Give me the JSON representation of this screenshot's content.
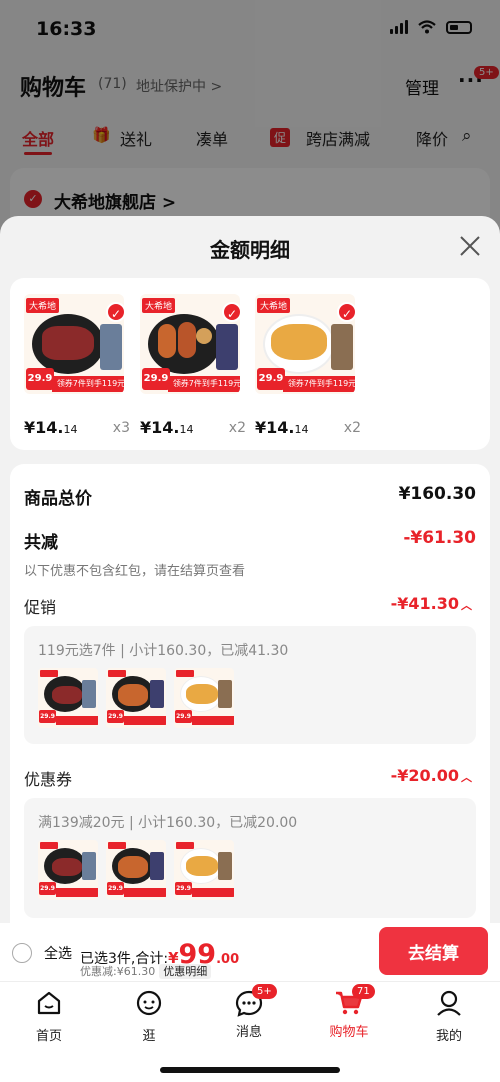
{
  "status_bar": {
    "time": "16:33"
  },
  "background": {
    "title": "购物车",
    "count": "(71)",
    "address_protect": "地址保护中 >",
    "manage": "管理",
    "more_badge": "5+",
    "tabs": [
      "全部",
      "送礼",
      "凑单",
      "跨店满减",
      "降价"
    ],
    "store_name": "大希地旗舰店 >"
  },
  "sheet": {
    "title": "金额明细",
    "products": [
      {
        "brand": "大希地",
        "tag_price": "29.9",
        "banner": "领券7件到手119元",
        "price_main": "¥14.",
        "price_dec": "14",
        "qty": "x3"
      },
      {
        "brand": "大希地",
        "tag_price": "29.9",
        "banner": "领券7件到手119元",
        "price_main": "¥14.",
        "price_dec": "14",
        "qty": "x2"
      },
      {
        "brand": "大希地",
        "tag_price": "29.9",
        "banner": "领券7件到手119元",
        "price_main": "¥14.",
        "price_dec": "14",
        "qty": "x2"
      }
    ],
    "total_label": "商品总价",
    "total_value": "¥160.30",
    "reduce_label": "共减",
    "reduce_value": "-¥61.30",
    "note": "以下优惠不包含红包，请在结算页查看",
    "promo_label": "促销",
    "promo_value": "-¥41.30",
    "promo_detail": "119元选7件 | 小计160.30，已减41.30",
    "coupon_label": "优惠券",
    "coupon_value": "-¥20.00",
    "coupon_detail": "满139减20元 | 小计160.30，已减20.00",
    "thumb_tag": "29.9"
  },
  "checkout": {
    "select_all": "全选",
    "selected": "已选3件,合计:",
    "yen": "¥",
    "amount_int": "99",
    "amount_dec": ".00",
    "discount": "优惠减:¥61.30",
    "detail_tag": "优惠明细",
    "pay_button": "去结算"
  },
  "tabbar": {
    "items": [
      {
        "label": "首页"
      },
      {
        "label": "逛"
      },
      {
        "label": "消息",
        "badge": "5+"
      },
      {
        "label": "购物车",
        "badge": "71"
      },
      {
        "label": "我的"
      }
    ]
  },
  "colors": {
    "accent": "#e8232a",
    "pay_button": "#ef3340"
  }
}
